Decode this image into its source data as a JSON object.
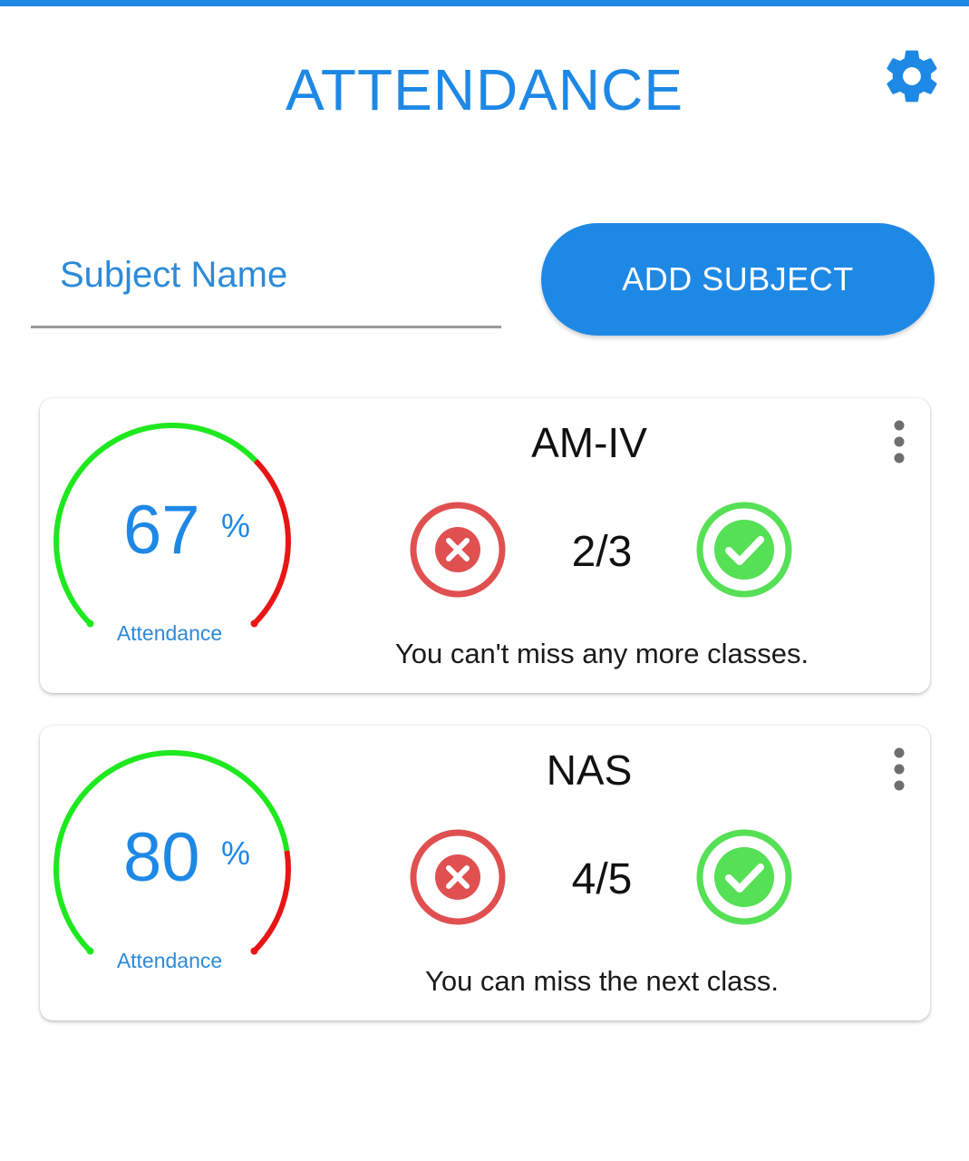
{
  "header": {
    "title": "ATTENDANCE",
    "settings_icon": "gear-icon"
  },
  "form": {
    "subject_placeholder": "Subject Name",
    "subject_value": "",
    "add_button_label": "ADD SUBJECT"
  },
  "colors": {
    "primary": "#1e88e5",
    "gauge_good": "#1ee81e",
    "gauge_bad": "#e81515",
    "absent": "#e05050",
    "present": "#55e055"
  },
  "subjects": [
    {
      "name": "AM-IV",
      "percent": "67",
      "percent_sign": "%",
      "gauge_label": "Attendance",
      "attendance_fraction": 0.67,
      "count": "2/3",
      "message": "You can't miss any more classes."
    },
    {
      "name": "NAS",
      "percent": "80",
      "percent_sign": "%",
      "gauge_label": "Attendance",
      "attendance_fraction": 0.8,
      "count": "4/5",
      "message": "You can miss the next class."
    }
  ]
}
